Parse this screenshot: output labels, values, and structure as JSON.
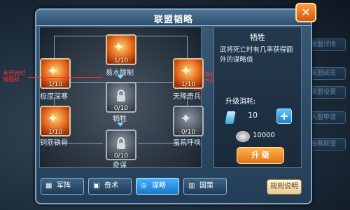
{
  "window": {
    "title": "联盟韬略",
    "close_symbol": "✕"
  },
  "side_menu": [
    "联盟详情",
    "联盟成员",
    "联盟设置",
    "入盟申请",
    "查看联盟"
  ],
  "skills": [
    {
      "name": "易水酸制",
      "level": "1/10",
      "locked": false
    },
    {
      "name": "极度深寒",
      "level": "1/10",
      "locked": false
    },
    {
      "name": "天降奇兵",
      "level": "1/10",
      "locked": false
    },
    {
      "name": "牺牲",
      "level": "0/10",
      "locked": true
    },
    {
      "name": "铜筋铁骨",
      "level": "1/10",
      "locked": false
    },
    {
      "name": "蛮荒呼唤",
      "level": "0/10",
      "locked": true
    },
    {
      "name": "奇谋",
      "level": "0/10",
      "locked": true
    }
  ],
  "annotations": {
    "left_line1": "未开启时",
    "left_line2": "锁图标",
    "right_line1": "等级为零时",
    "right_line2": "为灰色状态"
  },
  "detail": {
    "title": "牺牲",
    "description": "武将死亡时有几率获得额外的谋略值",
    "cost_label": "升级消耗:",
    "crystal_icon": "crystal-icon",
    "crystal_qty": "10",
    "plus_symbol": "+",
    "coin_amount": "10000",
    "upgrade_label": "升 级"
  },
  "tabs": [
    {
      "icon": "formation-icon",
      "label": "军阵",
      "active": false
    },
    {
      "icon": "strategy-icon",
      "label": "奇术",
      "active": false
    },
    {
      "icon": "swirl-icon",
      "label": "谋略",
      "active": true
    },
    {
      "icon": "bars-icon",
      "label": "国策",
      "active": false
    }
  ],
  "rules_label": "规则说明",
  "colors": {
    "accent": "#3aa6ff",
    "upgrade": "#f0901e",
    "annotation": "#ff3030"
  }
}
